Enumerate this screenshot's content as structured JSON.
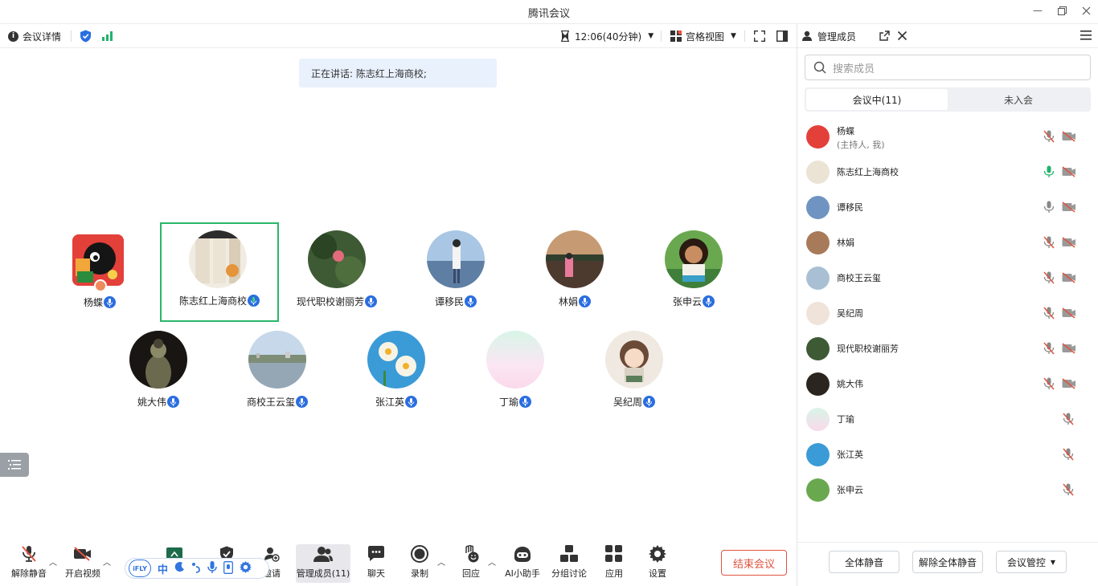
{
  "window": {
    "title": "腾讯会议"
  },
  "toolbar": {
    "meeting_info": "会议详情",
    "timer": "12:06(40分钟)",
    "view_mode": "宫格视图"
  },
  "speaking": "正在讲话: 陈志红上海商校;",
  "participants": [
    {
      "name": "杨蝶"
    },
    {
      "name": "陈志红上海商校"
    },
    {
      "name": "现代职校谢丽芳"
    },
    {
      "name": "谭移民"
    },
    {
      "name": "林娟"
    },
    {
      "name": "张申云"
    },
    {
      "name": "姚大伟"
    },
    {
      "name": "商校王云玺"
    },
    {
      "name": "张江英"
    },
    {
      "name": "丁瑜"
    },
    {
      "name": "吴纪周"
    }
  ],
  "bottombar": {
    "unmute": "解除静音",
    "video": "开启视频",
    "invite": "邀请",
    "manage": "管理成员(11)",
    "chat": "聊天",
    "record": "录制",
    "react": "回应",
    "ai": "AI小助手",
    "breakout": "分组讨论",
    "apps": "应用",
    "settings": "设置",
    "end": "结束会议",
    "ifly_logo": "iFLY",
    "ifly_lang": "中"
  },
  "panel": {
    "title": "管理成员",
    "search_placeholder": "搜索成员",
    "tab_in": "会议中(11)",
    "tab_out": "未入会",
    "members": [
      {
        "name": "杨蝶",
        "sub": "(主持人, 我)",
        "mic": "muted",
        "cam": "off"
      },
      {
        "name": "陈志红上海商校",
        "mic": "active",
        "cam": "off"
      },
      {
        "name": "谭移民",
        "mic": "on",
        "cam": "off"
      },
      {
        "name": "林娟",
        "mic": "muted",
        "cam": "off"
      },
      {
        "name": "商校王云玺",
        "mic": "muted",
        "cam": "off"
      },
      {
        "name": "吴纪周",
        "mic": "muted",
        "cam": "off"
      },
      {
        "name": "现代职校谢丽芳",
        "mic": "muted",
        "cam": "off"
      },
      {
        "name": "姚大伟",
        "mic": "muted",
        "cam": "off"
      },
      {
        "name": "丁瑜",
        "mic": "muted"
      },
      {
        "name": "张江英",
        "mic": "muted"
      },
      {
        "name": "张申云",
        "mic": "muted"
      }
    ],
    "mute_all": "全体静音",
    "unmute_all": "解除全体静音",
    "control": "会议管控"
  },
  "colors": {
    "accent": "#2a6ee0",
    "active_border": "#29b76a",
    "danger": "#e0533f"
  }
}
